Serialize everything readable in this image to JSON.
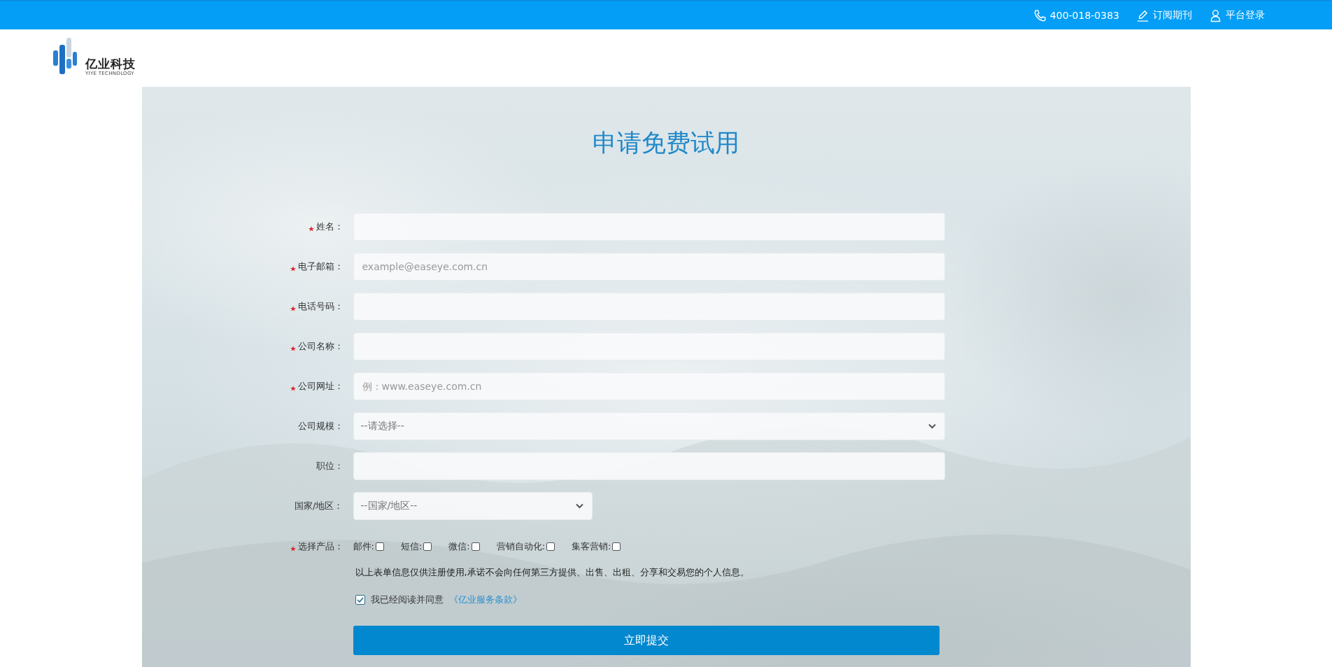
{
  "header": {
    "items": [
      {
        "kind": "phone",
        "text": "400-018-0383"
      },
      {
        "kind": "edit",
        "text": "订阅期刊"
      },
      {
        "kind": "user",
        "text": "平台登录"
      }
    ]
  },
  "logo": {
    "name": "亿业科技",
    "tagline": "YIYE TECHNOLOGY"
  },
  "form": {
    "title": "申请免费试用",
    "fields": [
      {
        "kind": "text",
        "label": "姓名：",
        "required": true
      },
      {
        "kind": "text",
        "label": "电子邮箱：",
        "required": true,
        "placeholder": "example@easeye.com.cn"
      },
      {
        "kind": "text",
        "label": "电话号码：",
        "required": true
      },
      {
        "kind": "text",
        "label": "公司名称：",
        "required": true
      },
      {
        "kind": "text",
        "label": "公司网址：",
        "required": true,
        "placeholder": "例：www.easeye.com.cn"
      },
      {
        "kind": "select",
        "label": "公司规模：",
        "required": false,
        "placeholder": "--请选择--"
      },
      {
        "kind": "text",
        "label": "职位：",
        "required": false
      },
      {
        "kind": "short-select",
        "label": "国家/地区：",
        "required": false,
        "placeholder": "--国家/地区--"
      }
    ],
    "products": {
      "label": "选择产品：",
      "required": true,
      "options": [
        {
          "label": "邮件:",
          "checked": false
        },
        {
          "label": "短信:",
          "checked": false
        },
        {
          "label": "微信:",
          "checked": false
        },
        {
          "label": "营销自动化:",
          "checked": false
        },
        {
          "label": "集客营销:",
          "checked": false
        }
      ]
    },
    "notice": "以上表单信息仅供注册使用,承诺不会向任何第三方提供、出售、出租、分享和交易您的个人信息。",
    "agree": {
      "text": "我已经阅读并同意",
      "link": "《亿业服务条款》",
      "checked": true
    },
    "submit": "立即提交"
  }
}
